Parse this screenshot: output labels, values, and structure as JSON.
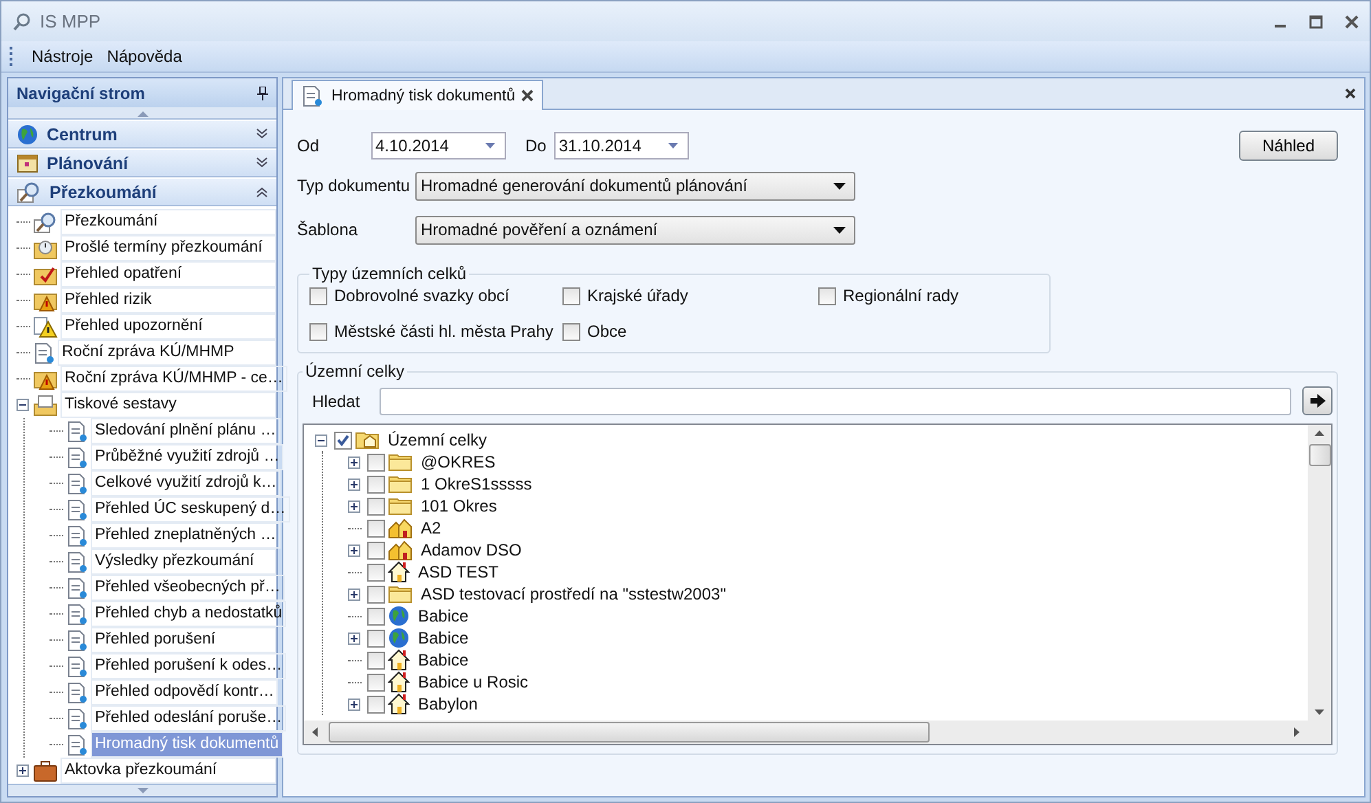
{
  "window": {
    "title": "IS MPP"
  },
  "menu": [
    "Nástroje",
    "Nápověda"
  ],
  "nav": {
    "title": "Navigační strom",
    "groups": [
      {
        "label": "Centrum",
        "kind": "globe",
        "expanded": false
      },
      {
        "label": "Plánování",
        "kind": "calendar",
        "expanded": false
      },
      {
        "label": "Přezkoumání",
        "kind": "search",
        "expanded": true
      }
    ],
    "items": [
      {
        "label": "Přezkoumání",
        "kind": "search",
        "selected": false
      },
      {
        "label": "Prošlé termíny přezkoumání",
        "kind": "clock",
        "selected": false
      },
      {
        "label": "Přehled opatření",
        "kind": "check",
        "selected": false
      },
      {
        "label": "Přehled rizik",
        "kind": "alert",
        "selected": false
      },
      {
        "label": "Přehled upozornění",
        "kind": "warning",
        "selected": false
      },
      {
        "label": "Roční zpráva KÚ/MHMP",
        "kind": "doc",
        "selected": false
      },
      {
        "label": "Roční zpráva KÚ/MHMP - ce…",
        "kind": "alert",
        "selected": false
      },
      {
        "label": "Tiskové sestavy",
        "kind": "print",
        "selected": false,
        "expanded": true,
        "children": [
          {
            "label": "Sledování plnění plánu …",
            "kind": "doc",
            "selected": false
          },
          {
            "label": "Průběžné využití zdrojů …",
            "kind": "doc",
            "selected": false
          },
          {
            "label": "Celkové využití zdrojů k…",
            "kind": "doc",
            "selected": false
          },
          {
            "label": "Přehled ÚC seskupený d…",
            "kind": "doc",
            "selected": false
          },
          {
            "label": "Přehled zneplatněných …",
            "kind": "doc",
            "selected": false
          },
          {
            "label": "Výsledky přezkoumání",
            "kind": "doc",
            "selected": false
          },
          {
            "label": "Přehled všeobecných př…",
            "kind": "doc",
            "selected": false
          },
          {
            "label": "Přehled chyb a nedostatků",
            "kind": "doc",
            "selected": false
          },
          {
            "label": "Přehled porušení",
            "kind": "doc",
            "selected": false
          },
          {
            "label": "Přehled porušení k odes…",
            "kind": "doc",
            "selected": false
          },
          {
            "label": "Přehled odpovědí kontr…",
            "kind": "doc",
            "selected": false
          },
          {
            "label": "Přehled odeslání poruše…",
            "kind": "doc",
            "selected": false
          },
          {
            "label": "Hromadný tisk dokumentů",
            "kind": "doc",
            "selected": true
          }
        ]
      },
      {
        "label": "Aktovka přezkoumání",
        "kind": "case",
        "selected": false,
        "expanded": false
      }
    ]
  },
  "tab": {
    "label": "Hromadný tisk dokumentů"
  },
  "form": {
    "from_label": "Od",
    "from": "4.10.2014",
    "to_label": "Do",
    "to": "31.10.2014",
    "preview": "Náhled",
    "doc_type_label": "Typ dokumentu",
    "doc_type": "Hromadné generování dokumentů plánování",
    "template_label": "Šablona",
    "template": "Hromadné pověření a oznámení"
  },
  "unit_types": {
    "title": "Typy územních celků",
    "options": [
      {
        "label": "Dobrovolné svazky obcí",
        "checked": false
      },
      {
        "label": "Krajské úřady",
        "checked": false
      },
      {
        "label": "Regionální rady",
        "checked": false
      },
      {
        "label": "Městské části hl. města Prahy",
        "checked": false
      },
      {
        "label": "Obce",
        "checked": false
      }
    ]
  },
  "units": {
    "title": "Územní celky",
    "search_label": "Hledat",
    "tree": {
      "label": "Územní celky",
      "kind": "root",
      "checked": true,
      "expanded": true,
      "children": [
        {
          "label": "@OKRES",
          "kind": "folder",
          "checked": false,
          "expanded": false
        },
        {
          "label": "1 OkreS1sssss",
          "kind": "folder",
          "checked": false,
          "expanded": false
        },
        {
          "label": "101 Okres",
          "kind": "folder",
          "checked": false,
          "expanded": false
        },
        {
          "label": "A2",
          "kind": "houses",
          "checked": false
        },
        {
          "label": "Adamov DSO",
          "kind": "houses",
          "checked": false,
          "expanded": false
        },
        {
          "label": "ASD TEST",
          "kind": "house",
          "checked": false
        },
        {
          "label": "ASD testovací prostředí na \"sstestw2003\"",
          "kind": "folder",
          "checked": false,
          "expanded": false
        },
        {
          "label": "Babice",
          "kind": "globe",
          "checked": false
        },
        {
          "label": "Babice",
          "kind": "globe",
          "checked": false,
          "expanded": false
        },
        {
          "label": "Babice",
          "kind": "house",
          "checked": false
        },
        {
          "label": "Babice u Rosic",
          "kind": "house",
          "checked": false
        },
        {
          "label": "Babylon",
          "kind": "house",
          "checked": false,
          "expanded": false
        }
      ]
    }
  }
}
